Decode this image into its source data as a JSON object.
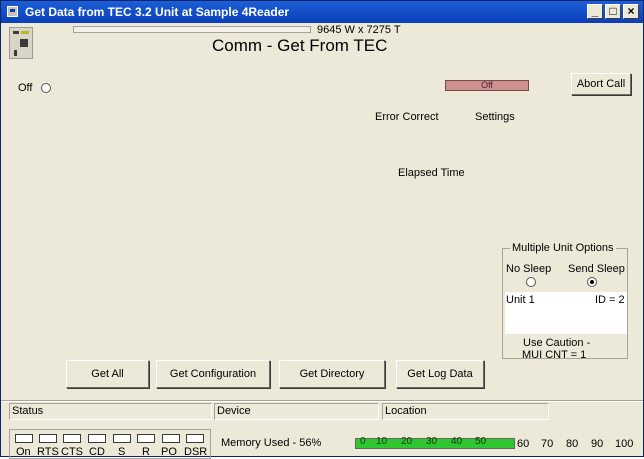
{
  "window": {
    "title": "Get Data from  TEC 3.2 Unit at Sample 4Reader",
    "controls": {
      "minimize": "_",
      "maximize": "□",
      "close": "×"
    }
  },
  "header": {
    "dimensions": "9645 W x 7275 T",
    "title": "Comm - Get From TEC",
    "off_label": "Off",
    "status_indicator": "Off",
    "abort_label": "Abort Call"
  },
  "info": {
    "error_correct": "Error Correct",
    "settings": "Settings",
    "elapsed_time": "Elapsed Time"
  },
  "multi_unit": {
    "title": "Multiple Unit Options",
    "no_sleep": "No Sleep",
    "send_sleep": "Send Sleep",
    "selected": "send_sleep",
    "unit": "Unit 1",
    "id": "ID = 2",
    "caution_1": "Use Caution  -",
    "caution_2": "MUI CNT = 1"
  },
  "actions": {
    "get_all": "Get All",
    "get_configuration": "Get Configuration",
    "get_directory": "Get Directory",
    "get_log_data": "Get Log Data"
  },
  "statusbar": {
    "status": "Status",
    "device": "Device",
    "location": "Location"
  },
  "leds": [
    "On",
    "RTS",
    "CTS",
    "CD",
    "S",
    "R",
    "PO",
    "DSR"
  ],
  "memory": {
    "label": "Memory Used - 56%",
    "used_fraction": 0.56,
    "scale": [
      "0",
      "10",
      "20",
      "30",
      "40",
      "50",
      "60",
      "70",
      "80",
      "90",
      "100"
    ]
  },
  "colors": {
    "title_bar": "#0a3fb8",
    "face": "#ece9d8",
    "off_indicator": "#cc9090",
    "memory_fill": "#2fc62f"
  }
}
